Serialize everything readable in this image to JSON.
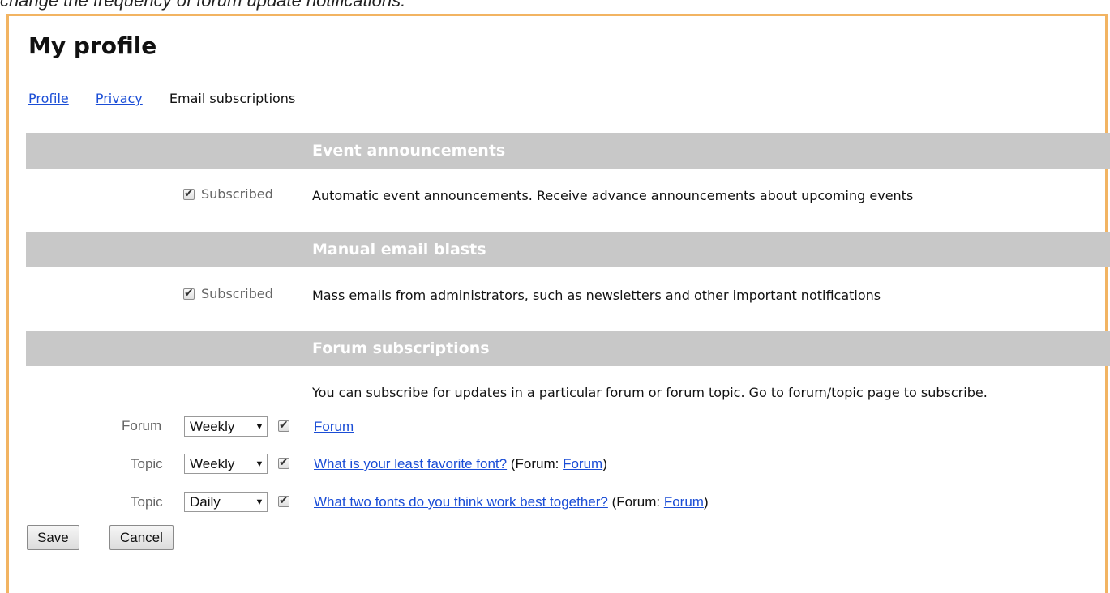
{
  "caption": "change the frequency of forum update notifications.",
  "page": {
    "title": "My profile"
  },
  "tabs": [
    {
      "label": "Profile"
    },
    {
      "label": "Privacy"
    },
    {
      "label": "Email subscriptions"
    }
  ],
  "sections": {
    "events": {
      "heading": "Event announcements",
      "checkbox_label": "Subscribed",
      "checked": true,
      "description": "Automatic event announcements. Receive advance announcements about upcoming events"
    },
    "blasts": {
      "heading": "Manual email blasts",
      "checkbox_label": "Subscribed",
      "checked": true,
      "description": "Mass emails from administrators, such as newsletters and other important notifications"
    },
    "forum": {
      "heading": "Forum subscriptions",
      "intro": "You can subscribe for updates in a particular forum or forum topic. Go to forum/topic page to subscribe.",
      "forum_prefix": "(Forum: ",
      "forum_suffix": ")",
      "rows": [
        {
          "type": "Forum",
          "frequency": "Weekly",
          "checked": true,
          "link": "Forum"
        },
        {
          "type": "Topic",
          "frequency": "Weekly",
          "checked": true,
          "link": "What is your least favorite font?",
          "forum_link": "Forum"
        },
        {
          "type": "Topic",
          "frequency": "Daily",
          "checked": true,
          "link": "What two fonts do you think work best together?",
          "forum_link": "Forum"
        }
      ]
    }
  },
  "buttons": {
    "save": "Save",
    "cancel": "Cancel"
  },
  "colors": {
    "frame_border": "#f2b462",
    "section_bar": "#c8c8c8",
    "link": "#1a4dd6"
  }
}
